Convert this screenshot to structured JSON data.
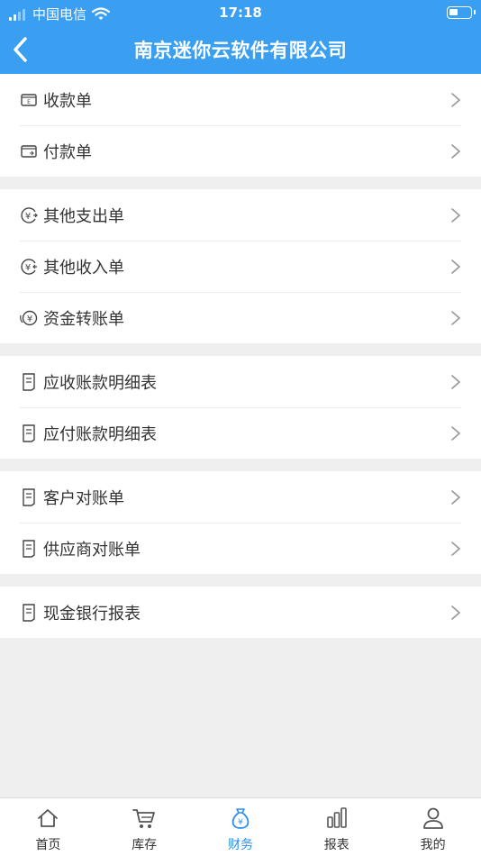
{
  "status_bar": {
    "carrier": "中国电信",
    "time": "17:18"
  },
  "header": {
    "title": "南京迷你云软件有限公司"
  },
  "colors": {
    "accent": "#3a9ff0",
    "active_tab": "#2e8ff0",
    "background": "#efefef"
  },
  "groups": [
    {
      "items": [
        {
          "label": "收款单",
          "icon": "receipt-icon"
        },
        {
          "label": "付款单",
          "icon": "wallet-icon"
        }
      ]
    },
    {
      "items": [
        {
          "label": "其他支出单",
          "icon": "yen-out-icon"
        },
        {
          "label": "其他收入单",
          "icon": "yen-in-icon"
        },
        {
          "label": "资金转账单",
          "icon": "yen-transfer-icon"
        }
      ]
    },
    {
      "items": [
        {
          "label": "应收账款明细表",
          "icon": "document-icon"
        },
        {
          "label": "应付账款明细表",
          "icon": "document-icon"
        }
      ]
    },
    {
      "items": [
        {
          "label": "客户对账单",
          "icon": "document-icon"
        },
        {
          "label": "供应商对账单",
          "icon": "document-icon"
        }
      ]
    },
    {
      "items": [
        {
          "label": "现金银行报表",
          "icon": "document-icon"
        }
      ]
    }
  ],
  "tabs": [
    {
      "label": "首页",
      "icon": "home-icon",
      "active": false
    },
    {
      "label": "库存",
      "icon": "cart-icon",
      "active": false
    },
    {
      "label": "财务",
      "icon": "money-bag-icon",
      "active": true
    },
    {
      "label": "报表",
      "icon": "bar-chart-icon",
      "active": false
    },
    {
      "label": "我的",
      "icon": "user-icon",
      "active": false
    }
  ]
}
